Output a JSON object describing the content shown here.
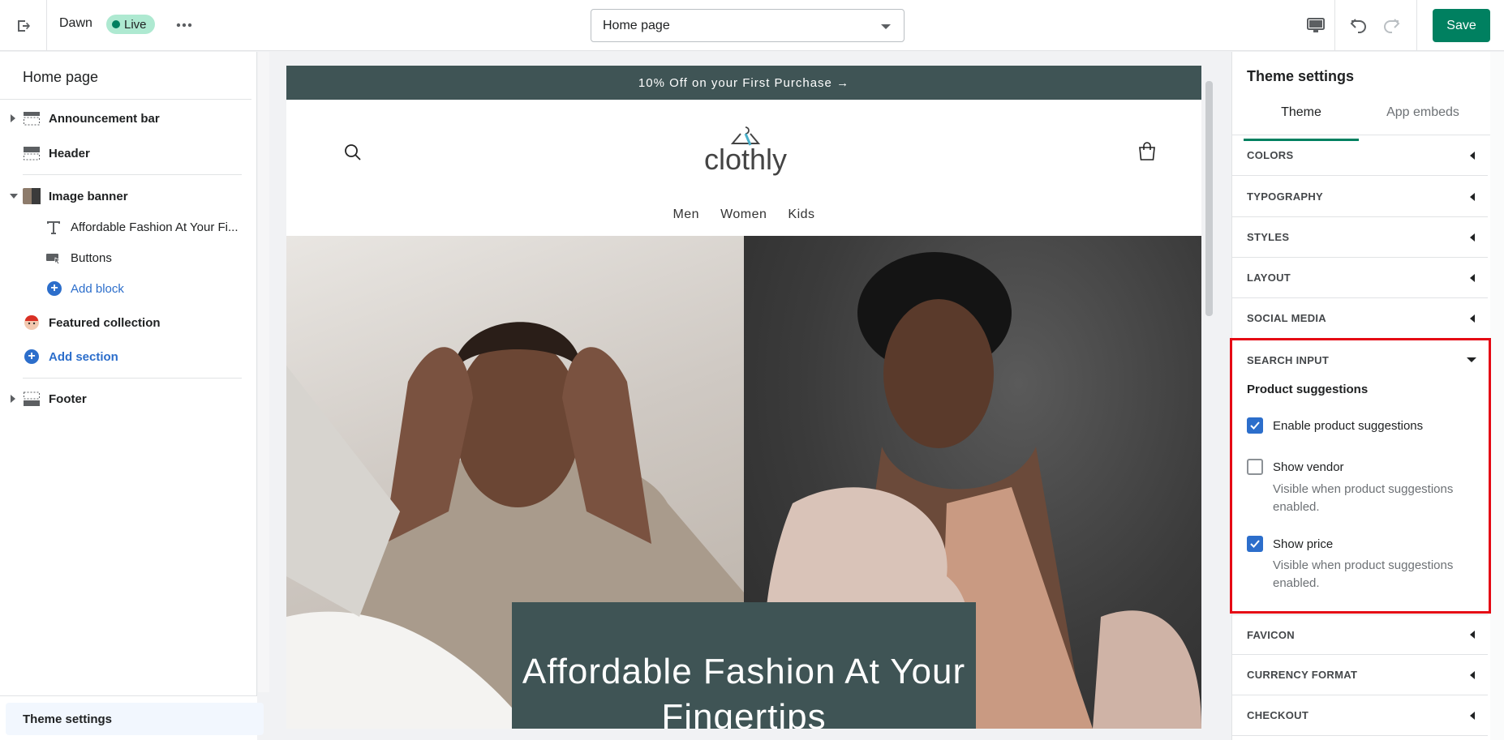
{
  "topbar": {
    "theme_name": "Dawn",
    "status": "Live",
    "page_selector": "Home page",
    "save_label": "Save"
  },
  "left_panel": {
    "title": "Home page",
    "sections": {
      "announcement": "Announcement bar",
      "header": "Header",
      "image_banner": "Image banner",
      "banner_heading": "Affordable Fashion At Your Fi...",
      "banner_buttons": "Buttons",
      "add_block": "Add block",
      "featured": "Featured collection",
      "add_section": "Add section",
      "footer": "Footer"
    },
    "theme_settings": "Theme settings"
  },
  "preview": {
    "announcement": "10% Off on your First Purchase  →",
    "logo": "clothly",
    "nav": [
      "Men",
      "Women",
      "Kids"
    ],
    "hero_text": "Affordable Fashion At Your Fingertips"
  },
  "right_panel": {
    "title": "Theme settings",
    "tabs": [
      "Theme",
      "App embeds"
    ],
    "accordions_top": [
      "COLORS",
      "TYPOGRAPHY",
      "STYLES",
      "LAYOUT",
      "SOCIAL MEDIA"
    ],
    "search_input": {
      "label": "SEARCH INPUT",
      "subheading": "Product suggestions",
      "enable": "Enable product suggestions",
      "enable_checked": true,
      "vendor": "Show vendor",
      "vendor_checked": false,
      "vendor_help": "Visible when product suggestions enabled.",
      "price": "Show price",
      "price_checked": true,
      "price_help": "Visible when product suggestions enabled."
    },
    "accordions_bottom": [
      "FAVICON",
      "CURRENCY FORMAT",
      "CHECKOUT"
    ]
  },
  "colors": {
    "accent": "#008060",
    "link": "#2c6ecb",
    "banner": "#3f5455",
    "highlight": "#e50914"
  }
}
